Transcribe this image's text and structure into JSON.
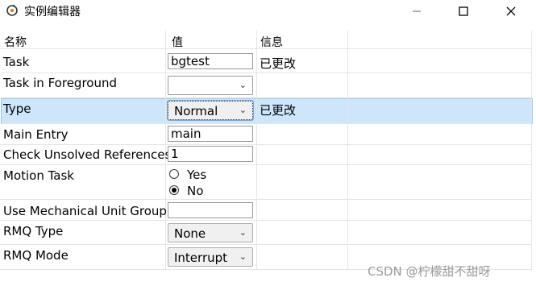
{
  "window": {
    "title": "实例编辑器"
  },
  "columns": [
    "名称",
    "值",
    "信息"
  ],
  "rows": {
    "task": {
      "name": "Task",
      "value": "bgtest",
      "info": "已更改"
    },
    "task_fg": {
      "name": "Task in Foreground",
      "value": ""
    },
    "type": {
      "name": "Type",
      "value": "Normal",
      "info": "已更改"
    },
    "main_entry": {
      "name": "Main Entry",
      "value": "main"
    },
    "check_unsolved": {
      "name": "Check Unsolved References",
      "value": "1"
    },
    "motion_task": {
      "name": "Motion Task",
      "options": [
        "Yes",
        "No"
      ],
      "selected": "No"
    },
    "mech_unit": {
      "name": "Use Mechanical Unit Group",
      "value": ""
    },
    "rmq_type": {
      "name": "RMQ Type",
      "value": "None"
    },
    "rmq_mode": {
      "name": "RMQ Mode",
      "value": "Interrupt"
    }
  },
  "watermark": "CSDN @柠檬甜不甜呀",
  "icons": {
    "app": "app-cycle-icon",
    "minimize": "minimize-icon",
    "maximize": "maximize-icon",
    "close": "close-icon",
    "dropdown": "chevron-down-icon"
  },
  "colors": {
    "selected_row": "#cde6fb",
    "selected_border": "#99c9f2",
    "grid_line": "#e5e5e5"
  }
}
